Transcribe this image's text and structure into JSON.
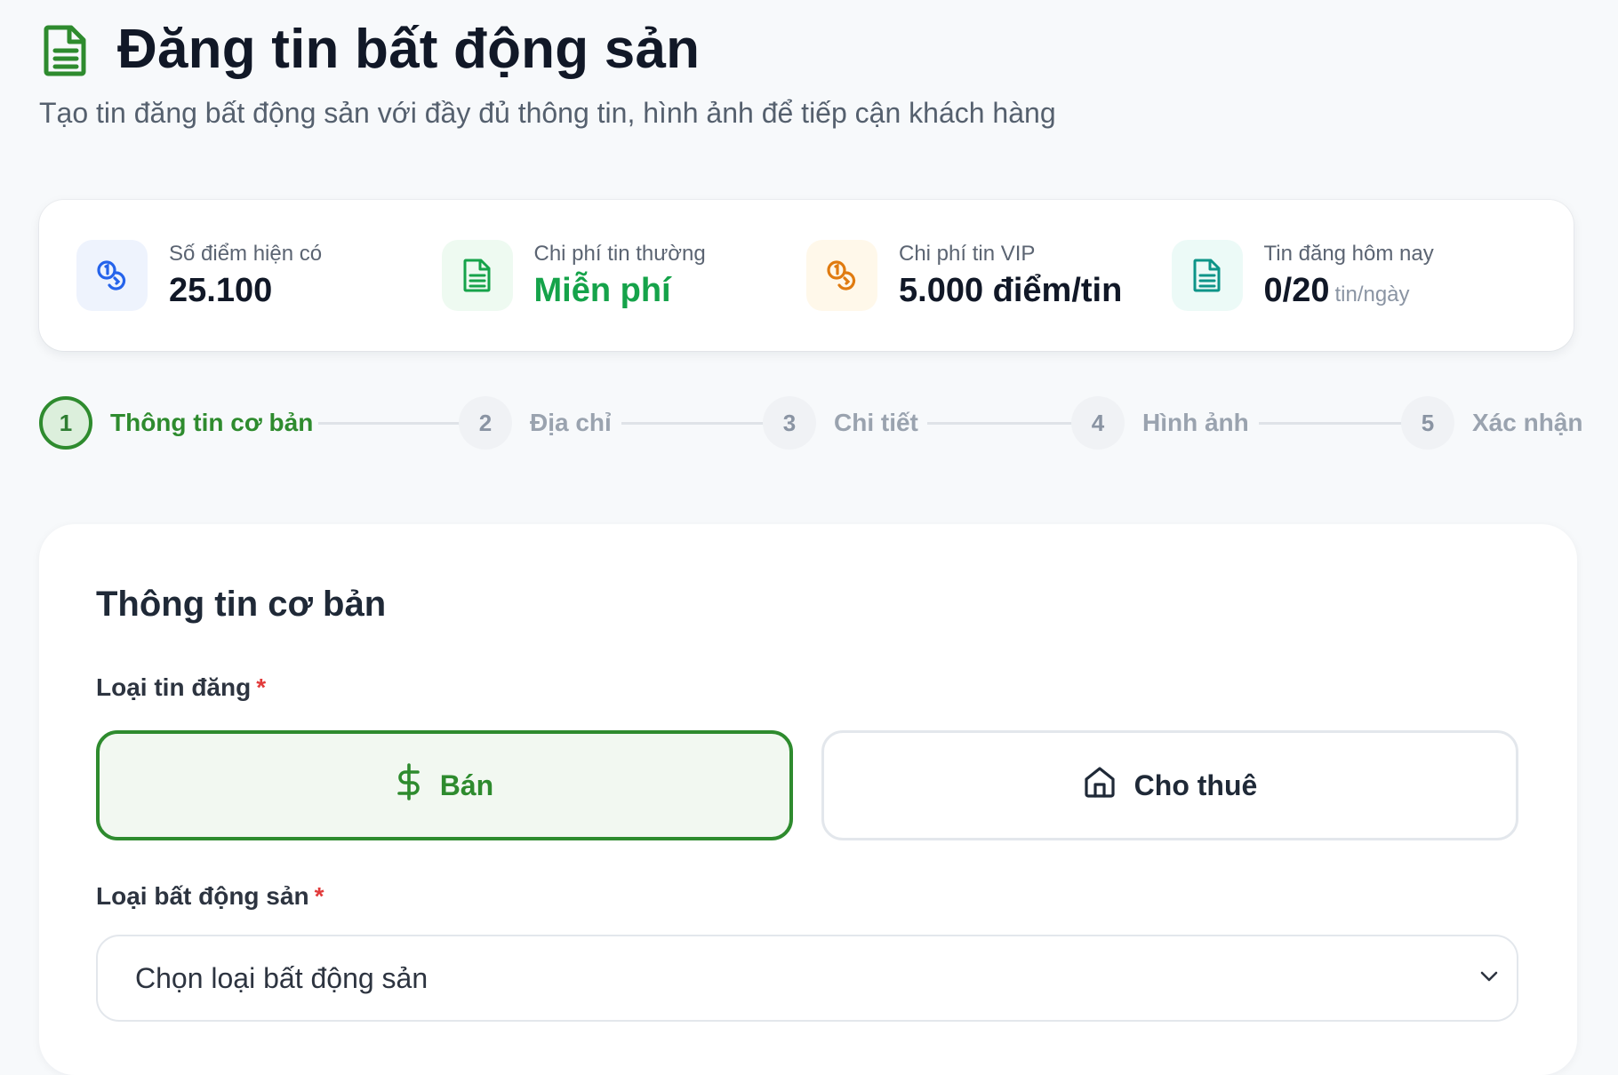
{
  "header": {
    "title": "Đăng tin bất động sản",
    "subtitle": "Tạo tin đăng bất động sản với đầy đủ thông tin, hình ảnh để tiếp cận khách hàng",
    "title_icon": "document-icon"
  },
  "stats": [
    {
      "label": "Số điểm hiện có",
      "value": "25.100",
      "suffix": "",
      "icon": "coins-icon",
      "icon_color": "#2563eb",
      "icon_bg": "#eef3fd"
    },
    {
      "label": "Chi phí tin thường",
      "value": "Miễn phí",
      "suffix": "",
      "icon": "document-icon",
      "icon_color": "#16a34a",
      "icon_bg": "#eefaf1"
    },
    {
      "label": "Chi phí tin VIP",
      "value": "5.000 điểm/tin",
      "suffix": "",
      "icon": "coins-icon",
      "icon_color": "#e07b10",
      "icon_bg": "#fff8ea"
    },
    {
      "label": "Tin đăng hôm nay",
      "value": "0/20",
      "suffix": "tin/ngày",
      "icon": "document-icon",
      "icon_color": "#0d9488",
      "icon_bg": "#ecfaf7"
    }
  ],
  "stepper": {
    "steps": [
      {
        "number": "1",
        "label": "Thông tin cơ bản",
        "active": true
      },
      {
        "number": "2",
        "label": "Địa chỉ",
        "active": false
      },
      {
        "number": "3",
        "label": "Chi tiết",
        "active": false
      },
      {
        "number": "4",
        "label": "Hình ảnh",
        "active": false
      },
      {
        "number": "5",
        "label": "Xác nhận",
        "active": false
      }
    ]
  },
  "form": {
    "section_title": "Thông tin cơ bản",
    "listing_type": {
      "label": "Loại tin đăng",
      "required_mark": "*",
      "options": [
        {
          "label": "Bán",
          "icon": "dollar-icon",
          "selected": true
        },
        {
          "label": "Cho thuê",
          "icon": "home-icon",
          "selected": false
        }
      ]
    },
    "property_type": {
      "label": "Loại bất động sản",
      "required_mark": "*",
      "placeholder": "Chọn loại bất động sản",
      "icon": "chevron-down-icon"
    }
  },
  "colors": {
    "primary_green": "#2e8b2e",
    "page_bg": "#f7f9fb",
    "required_red": "#e23b3b"
  }
}
